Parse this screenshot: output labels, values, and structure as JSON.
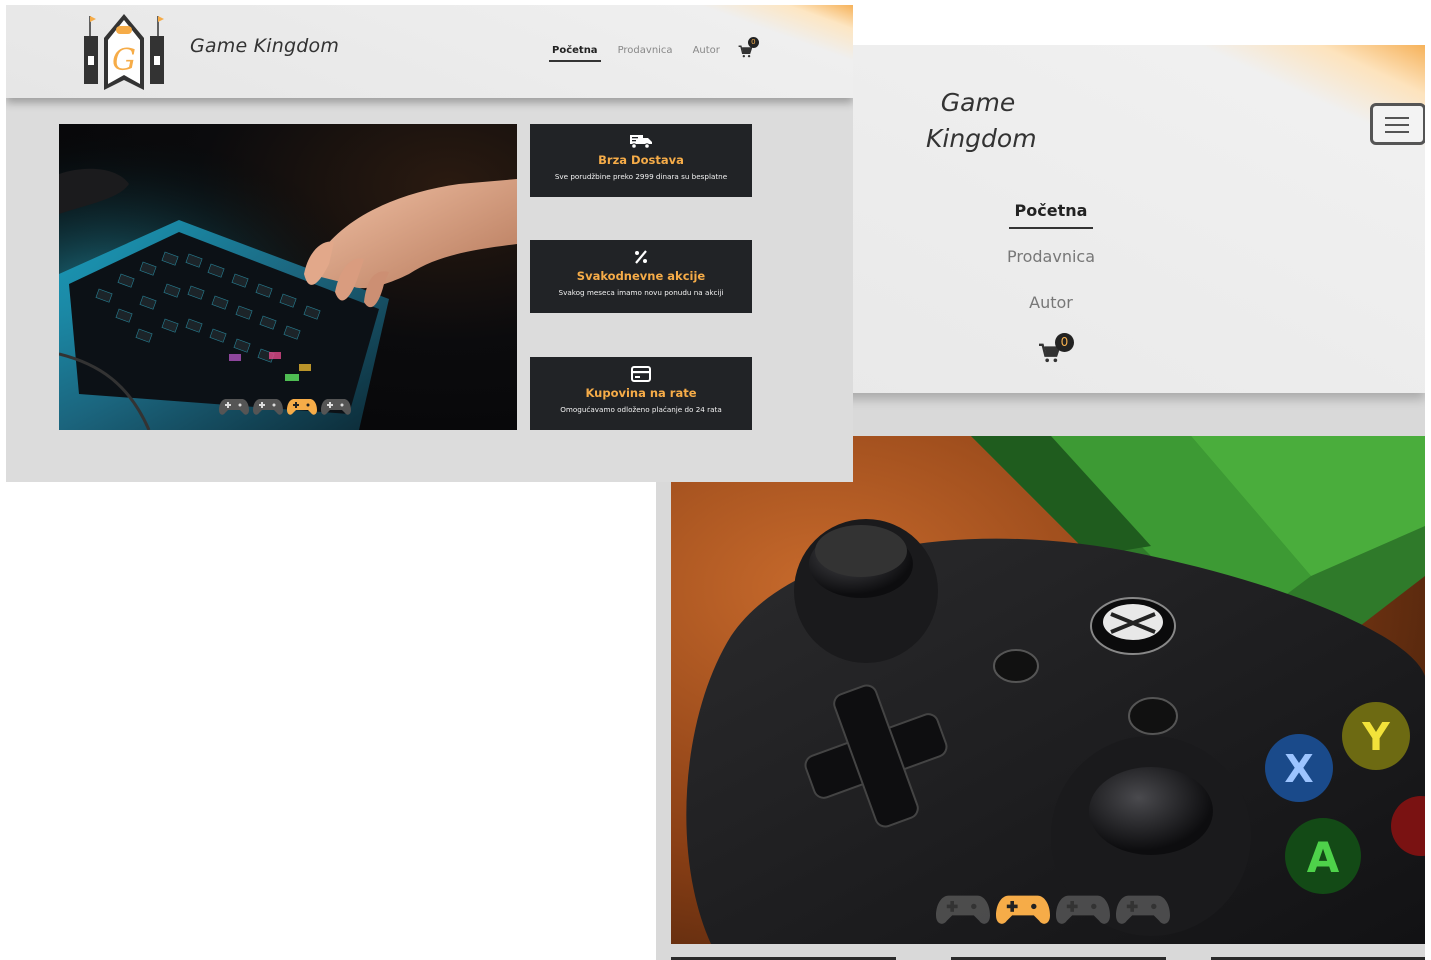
{
  "brand": {
    "name": "Game Kingdom",
    "name_line1": "Game",
    "name_line2": "Kingdom",
    "logo_letter": "G"
  },
  "nav": {
    "items": [
      {
        "label": "Početna",
        "active": true
      },
      {
        "label": "Prodavnica",
        "active": false
      },
      {
        "label": "Autor",
        "active": false
      }
    ],
    "cart_count_desktop": "0",
    "cart_count_mobile": "0"
  },
  "features": [
    {
      "icon": "truck-icon",
      "title": "Brza Dostava",
      "subtitle": "Sve porudžbine preko 2999 dinara su besplatne"
    },
    {
      "icon": "percent-icon",
      "title": "Svakodnevne akcije",
      "subtitle": "Svakog meseca imamo novu ponudu na akciji"
    },
    {
      "icon": "credit-card-icon",
      "title": "Kupovina na rate",
      "subtitle": "Omogućavamo odloženo plaćanje do 24 rata"
    }
  ],
  "slider": {
    "desktop_active_index": 2,
    "mobile_active_index": 1,
    "count": 4
  },
  "colors": {
    "accent": "#f6ac48",
    "dark_card": "#212326",
    "page_bg": "#dcdcdc",
    "dot_inactive": "#555555"
  }
}
